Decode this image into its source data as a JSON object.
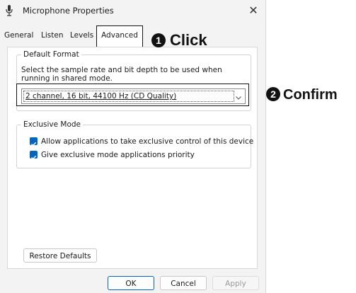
{
  "window": {
    "title": "Microphone Properties",
    "close_glyph": "✕"
  },
  "tabs": [
    {
      "label": "General"
    },
    {
      "label": "Listen"
    },
    {
      "label": "Levels"
    },
    {
      "label": "Advanced",
      "selected": true
    }
  ],
  "default_format": {
    "legend": "Default Format",
    "description": "Select the sample rate and bit depth to be used when running in shared mode.",
    "selected_value": "2 channel, 16 bit, 44100 Hz (CD Quality)"
  },
  "exclusive_mode": {
    "legend": "Exclusive Mode",
    "options": [
      {
        "label": "Allow applications to take exclusive control of this device",
        "checked": true
      },
      {
        "label": "Give exclusive mode applications priority",
        "checked": true
      }
    ]
  },
  "buttons": {
    "restore_defaults": "Restore Defaults",
    "ok": "OK",
    "cancel": "Cancel",
    "apply": "Apply"
  },
  "annotations": {
    "step1_number": "1",
    "step1_label": "Click",
    "step2_number": "2",
    "step2_label": "Confirm"
  },
  "colors": {
    "accent": "#0067c0",
    "dialog_background": "#f3f3f3",
    "panel_background": "#ffffff"
  },
  "icons": {
    "title_icon": "microphone-icon",
    "close_icon": "close-icon",
    "dropdown_icon": "chevron-down-icon",
    "check_icon": "checkmark-icon"
  }
}
